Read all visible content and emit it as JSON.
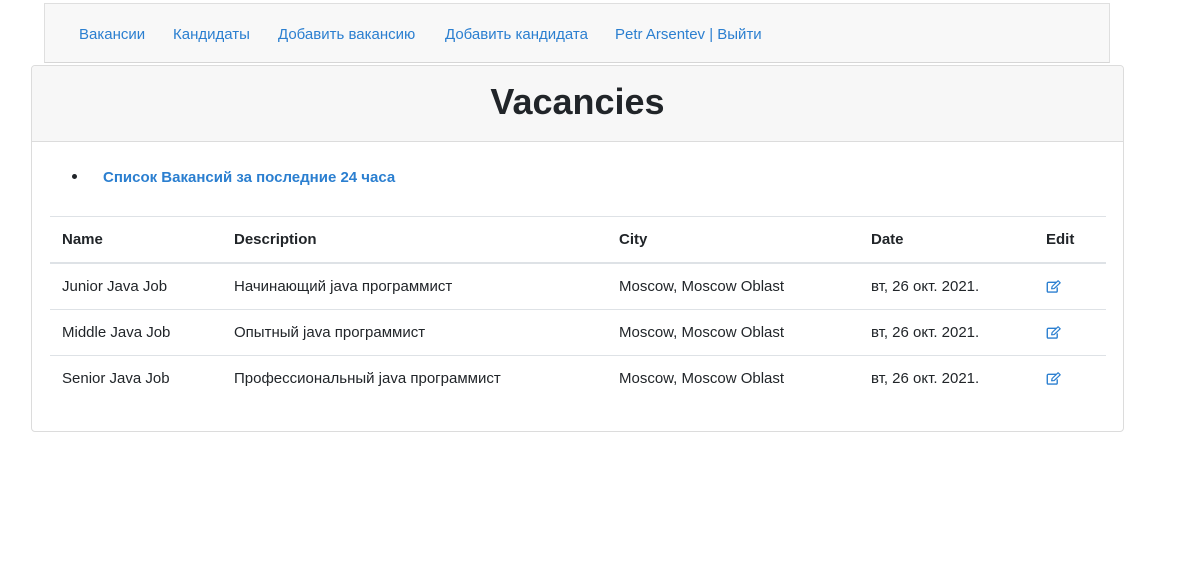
{
  "nav": {
    "items": [
      {
        "label": "Вакансии"
      },
      {
        "label": "Кандидаты"
      },
      {
        "label": "Добавить вакансию"
      },
      {
        "label": "Добавить кандидата"
      },
      {
        "label": "Petr Arsentev | Выйти"
      }
    ]
  },
  "page": {
    "title": "Vacancies",
    "recent_link": "Список Вакансий за последние 24 часа"
  },
  "table": {
    "headers": {
      "name": "Name",
      "description": "Description",
      "city": "City",
      "date": "Date",
      "edit": "Edit"
    },
    "rows": [
      {
        "name": "Junior Java Job",
        "description": "Начинающий java программист",
        "city": "Moscow, Moscow Oblast",
        "date": "вт, 26 окт. 2021.",
        "edit_icon": "edit-icon"
      },
      {
        "name": "Middle Java Job",
        "description": "Опытный java программист",
        "city": "Moscow, Moscow Oblast",
        "date": "вт, 26 окт. 2021.",
        "edit_icon": "edit-icon"
      },
      {
        "name": "Senior Java Job",
        "description": "Профессиональный java программист",
        "city": "Moscow, Moscow Oblast",
        "date": "вт, 26 окт. 2021.",
        "edit_icon": "edit-icon"
      }
    ]
  },
  "colors": {
    "link": "#2b7fd0",
    "text": "#212529",
    "header_bg": "#f7f7f7"
  }
}
